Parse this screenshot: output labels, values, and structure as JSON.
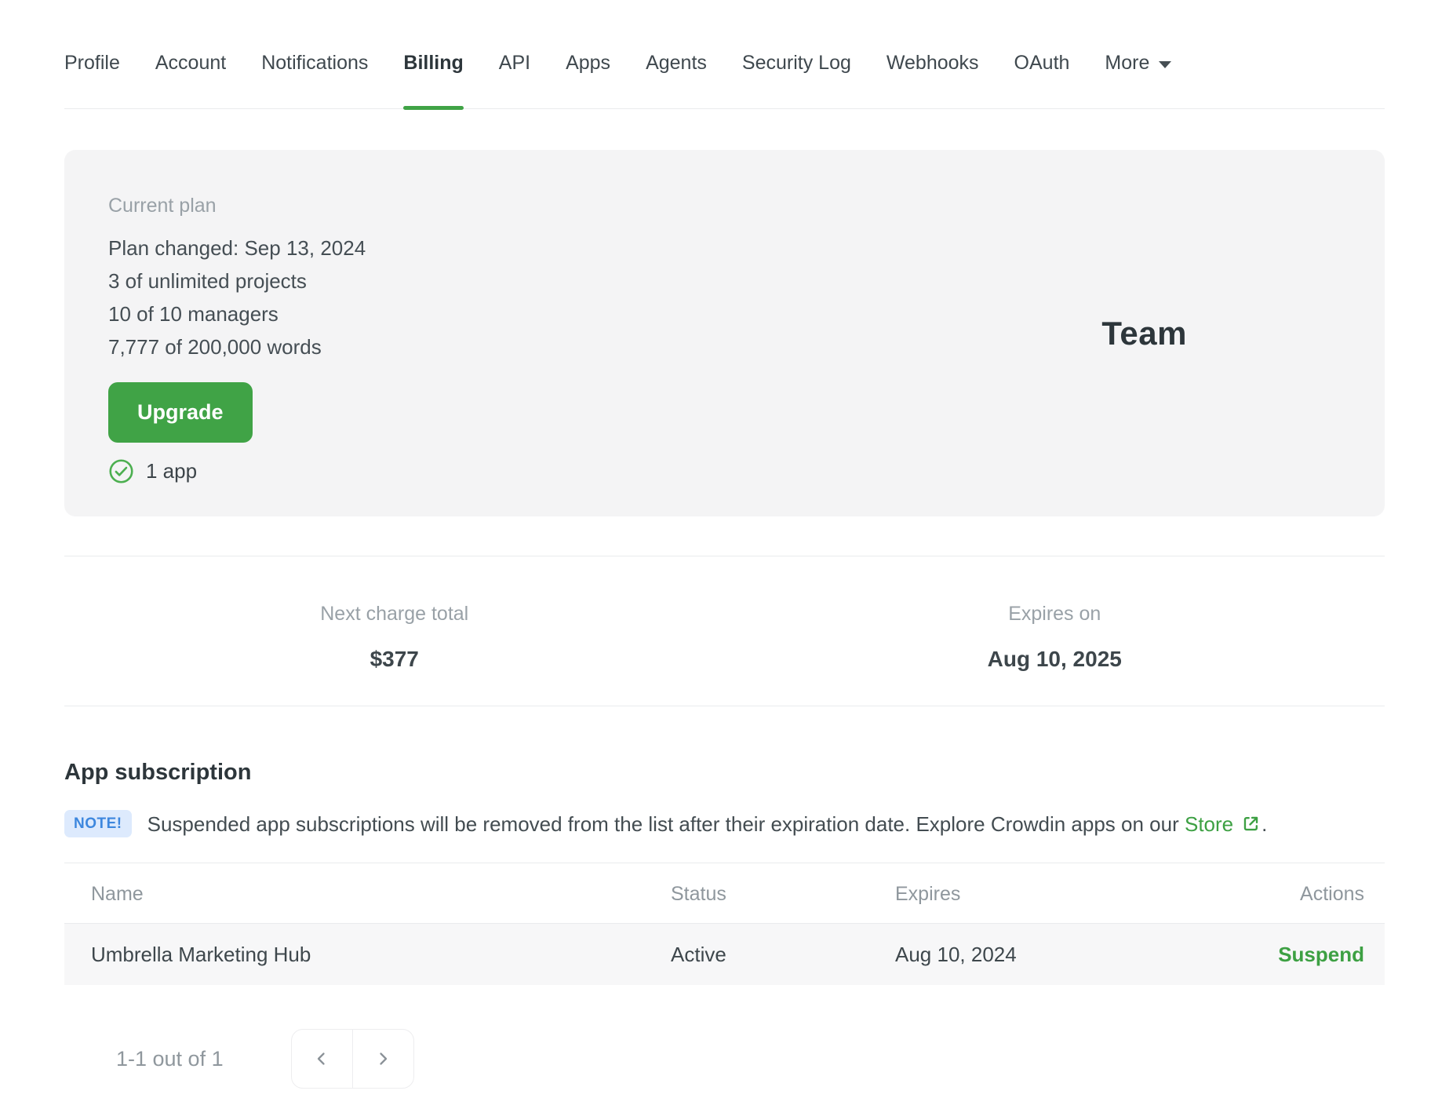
{
  "tabs": {
    "items": [
      {
        "label": "Profile",
        "active": false
      },
      {
        "label": "Account",
        "active": false
      },
      {
        "label": "Notifications",
        "active": false
      },
      {
        "label": "Billing",
        "active": true
      },
      {
        "label": "API",
        "active": false
      },
      {
        "label": "Apps",
        "active": false
      },
      {
        "label": "Agents",
        "active": false
      },
      {
        "label": "Security Log",
        "active": false
      },
      {
        "label": "Webhooks",
        "active": false
      },
      {
        "label": "OAuth",
        "active": false
      },
      {
        "label": "More",
        "active": false,
        "has_caret": true
      }
    ]
  },
  "plan_card": {
    "label": "Current plan",
    "details": [
      "Plan changed: Sep 13, 2024",
      "3 of unlimited projects",
      "10 of 10 managers",
      "7,777 of 200,000 words"
    ],
    "upgrade_label": "Upgrade",
    "apps_note": "1 app",
    "plan_name": "Team"
  },
  "billing_summary": {
    "next_charge": {
      "label": "Next charge total",
      "value": "$377"
    },
    "expires": {
      "label": "Expires on",
      "value": "Aug 10, 2025"
    }
  },
  "app_subscription": {
    "title": "App subscription",
    "note_badge": "NOTE!",
    "note_text_before": "Suspended app subscriptions will be removed from the list after their expiration date. Explore Crowdin apps on our ",
    "store_link_label": "Store",
    "note_text_after": ".",
    "table": {
      "headers": [
        "Name",
        "Status",
        "Expires",
        "Actions"
      ],
      "rows": [
        {
          "name": "Umbrella Marketing Hub",
          "status": "Active",
          "expires": "Aug 10, 2024",
          "action": "Suspend"
        }
      ]
    },
    "pagination": {
      "label": "1-1 out of 1"
    }
  },
  "colors": {
    "accent_green": "#40a346",
    "link_green": "#3da043",
    "note_blue": "#3d87de",
    "note_bg": "#ddeafd",
    "card_bg": "#f4f4f5",
    "row_bg": "#f7f7f8"
  }
}
